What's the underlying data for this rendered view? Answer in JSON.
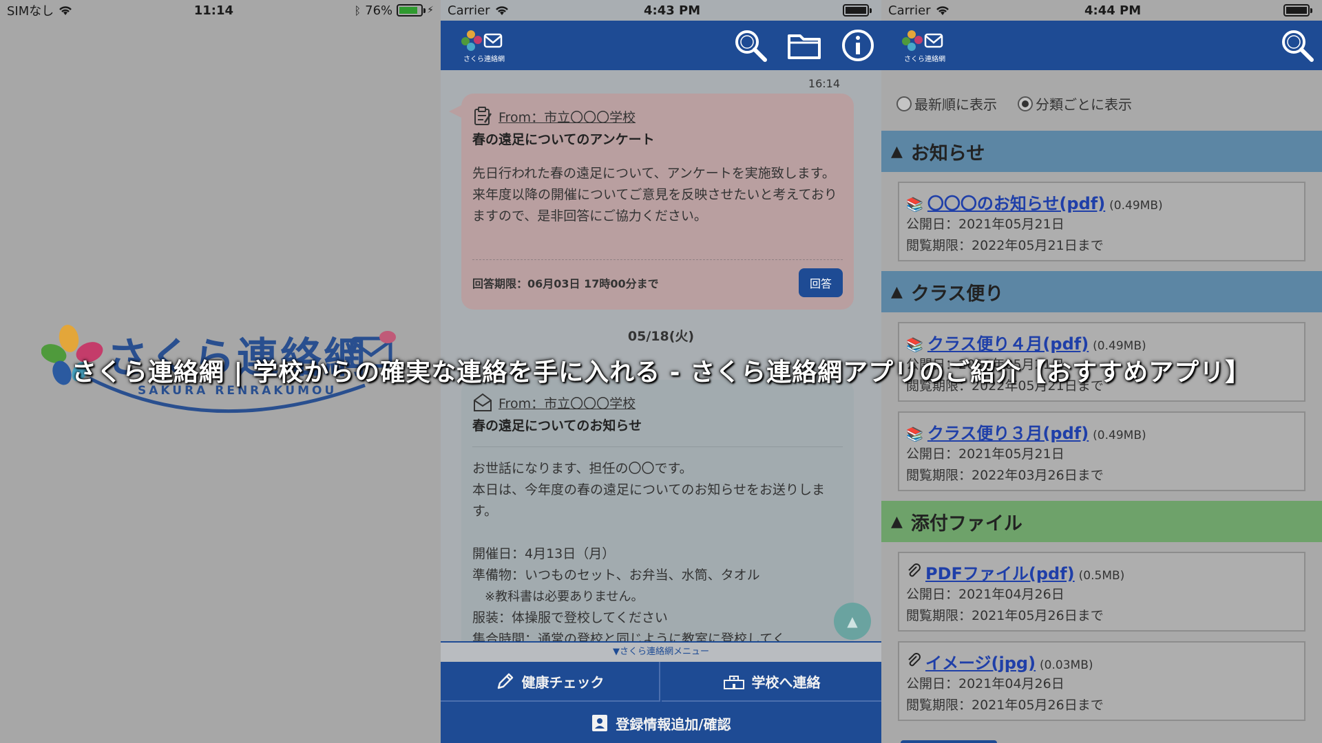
{
  "left": {
    "status": {
      "carrier": "SIMなし",
      "time": "11:14",
      "battery": "76%"
    },
    "logo": {
      "title": "さくら連絡網",
      "roman": "SAKURA RENRAKUMOU"
    }
  },
  "mid": {
    "status": {
      "carrier": "Carrier",
      "time": "4:43 PM"
    },
    "app_logo_text": "さくら連絡網",
    "time_stamp": "16:14",
    "survey": {
      "from": "From：市立〇〇〇学校",
      "title": "春の遠足についてのアンケート",
      "body1": "先日行われた春の遠足について、アンケートを実施致します。",
      "body2": "来年度以降の開催についてご意見を反映させたいと考えておりますので、是非回答にご協力ください。",
      "deadline": "回答期限：06月03日 17時00分まで",
      "reply_label": "回答"
    },
    "date_separator": "05/18(火)",
    "notice": {
      "from": "From：市立〇〇〇学校",
      "title": "春の遠足についてのお知らせ",
      "lines": [
        "お世話になります、担任の〇〇です。",
        "本日は、今年度の春の遠足についてのお知らせをお送りします。",
        "",
        "開催日：4月13日（月）",
        "準備物：いつものセット、お弁当、水筒、タオル",
        "　※教科書は必要ありません。",
        "服装：体操服で登校してください",
        "集合時間：通常の登校と同じように教室に登校してく"
      ]
    },
    "menu_label": "▼さくら連絡網メニュー",
    "menu": {
      "health": "健康チェック",
      "school": "学校へ連絡",
      "register": "登録情報追加/確認"
    }
  },
  "right": {
    "status": {
      "carrier": "Carrier",
      "time": "4:44 PM"
    },
    "app_logo_text": "さくら連絡網",
    "sort": {
      "newest": "最新順に表示",
      "category": "分類ごとに表示"
    },
    "sections": [
      {
        "title": "お知らせ",
        "items": [
          {
            "name": "〇〇〇のお知らせ(pdf)",
            "size": "(0.49MB)",
            "published": "公開日：2021年05月21日",
            "expires": "閲覧期限：2022年05月21日まで"
          }
        ]
      },
      {
        "title": "クラス便り",
        "items": [
          {
            "name": "クラス便り４月(pdf)",
            "size": "(0.49MB)",
            "published": "公開日：2021年05月21日",
            "expires": "閲覧期限：2022年05月21日まで"
          },
          {
            "name": "クラス便り３月(pdf)",
            "size": "(0.49MB)",
            "published": "公開日：2021年05月21日",
            "expires": "閲覧期限：2022年03月26日まで"
          }
        ]
      },
      {
        "title": "添付ファイル",
        "items": [
          {
            "name": "PDFファイル(pdf)",
            "size": "(0.5MB)",
            "published": "公開日：2021年04月26日",
            "expires": "閲覧期限：2021年05月26日まで"
          },
          {
            "name": "イメージ(jpg)",
            "size": "(0.03MB)",
            "published": "公開日：2021年04月26日",
            "expires": "閲覧期限：2021年05月26日まで"
          }
        ]
      }
    ]
  },
  "overlay_title": "さくら連絡網 | 学校からの確実な連絡を手に入れる - さくら連絡網アプリのご紹介【おすすめアプリ】",
  "colors": {
    "brand_blue": "#1e4b94",
    "section_blue": "#5c86a4",
    "section_green": "#6ea26a",
    "survey_pink": "#b99fa0",
    "link_blue": "#1f3fa8"
  }
}
